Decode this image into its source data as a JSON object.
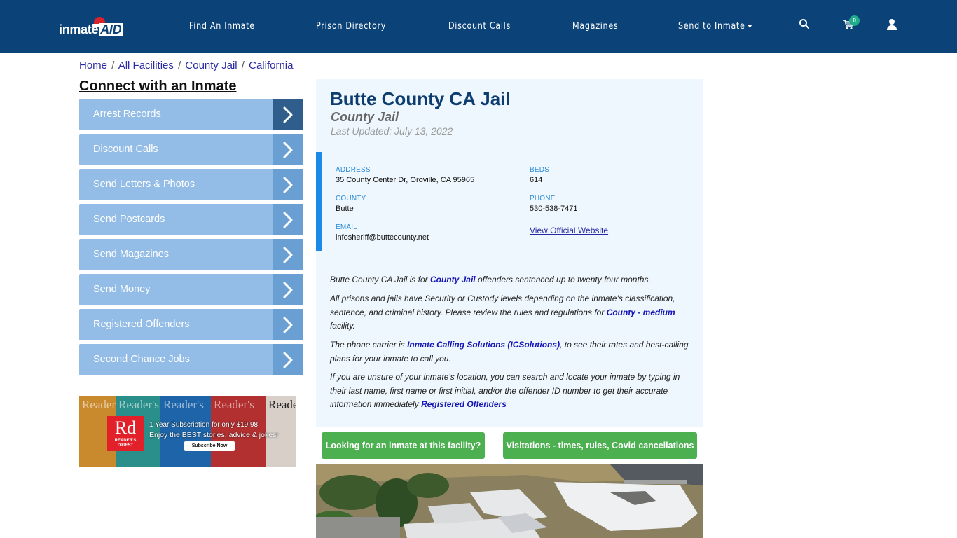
{
  "navbar": {
    "logo": {
      "text": "inmate",
      "accent": "AID"
    },
    "items": [
      {
        "label": "Find An Inmate"
      },
      {
        "label": "Prison Directory"
      },
      {
        "label": "Discount Calls"
      },
      {
        "label": "Magazines"
      },
      {
        "label": "Send to Inmate",
        "has_dropdown": true
      }
    ],
    "icons": [
      "search-icon",
      "cart-icon",
      "user-icon"
    ],
    "cart_count": "0",
    "colors": {
      "background": "#0b4277",
      "badge": "#1fae8b"
    }
  },
  "breadcrumb": [
    {
      "label": "Home"
    },
    {
      "label": "All Facilities"
    },
    {
      "label": "County Jail"
    },
    {
      "label": "California"
    }
  ],
  "breadcrumb_separator": "/",
  "sidebar": {
    "title": "Connect with an Inmate",
    "items": [
      {
        "label": "Arrest Records",
        "active": true
      },
      {
        "label": "Discount Calls"
      },
      {
        "label": "Send Letters & Photos"
      },
      {
        "label": "Send Postcards"
      },
      {
        "label": "Send Magazines"
      },
      {
        "label": "Send Money"
      },
      {
        "label": "Registered Offenders"
      },
      {
        "label": "Second Chance Jobs"
      }
    ],
    "colors": {
      "item_bg": "#93bde6",
      "arrow_bg": "#6a9fd3",
      "arrow_active_bg": "#2f5d8c"
    }
  },
  "ad": {
    "brand_big": "Rd",
    "brand_small": "READER'S DIGEST",
    "mastheads": [
      "Reader's",
      "Reader's",
      "Reader's",
      "Reader's",
      "Reader's"
    ],
    "line1": "1 Year Subscription for only $19.98",
    "line2": "Enjoy the BEST stories, advice & jokes!",
    "button": "Subscribe Now"
  },
  "facility": {
    "name": "Butte County CA Jail",
    "type": "County Jail",
    "last_updated": "Last Updated: July 13, 2022",
    "fields": {
      "address_label": "ADDRESS",
      "address": "35 County Center Dr, Oroville, CA 95965",
      "beds_label": "BEDS",
      "beds": "614",
      "county_label": "COUNTY",
      "county": "Butte",
      "phone_label": "PHONE",
      "phone": "530-538-7471",
      "email_label": "EMAIL",
      "email": "infosheriff@buttecounty.net",
      "website_link": "View Official Website"
    },
    "paragraphs": {
      "p1_a": "Butte County CA Jail is for ",
      "p1_link": "County Jail",
      "p1_b": " offenders sentenced up to twenty four months.",
      "p2_a": "All prisons and jails have Security or Custody levels depending on the inmate's classification, sentence, and criminal history. Please review the rules and regulations for ",
      "p2_link": "County - medium",
      "p2_b": " facility.",
      "p3_a": "The phone carrier is ",
      "p3_link": "Inmate Calling Solutions (ICSolutions)",
      "p3_b": ", to see their rates and best-calling plans for your inmate to call you.",
      "p4_a": "If you are unsure of your inmate's location, you can search and locate your inmate by typing in their last name, first name or first initial, and/or the offender ID number to get their accurate information immediately ",
      "p4_link": "Registered Offenders"
    },
    "colors": {
      "title": "#0d3d6e",
      "card_bg": "#eef7fd",
      "accent_bar": "#1a8ae6"
    }
  },
  "actions": {
    "find_inmate": "Looking for an inmate at this facility?",
    "visitations": "Visitations - times, rules, Covid cancellations",
    "color": "#4caf50"
  },
  "photo": {
    "description": "aerial-view-of-facility"
  }
}
